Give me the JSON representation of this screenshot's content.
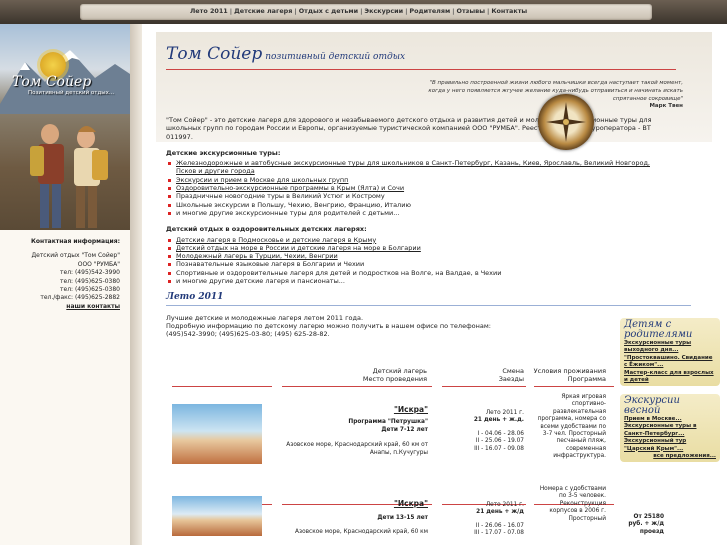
{
  "nav": {
    "items": [
      "Лето 2011",
      "Детские лагеря",
      "Отдых с детьми",
      "Экскурсии",
      "Родителям",
      "Отзывы",
      "Контакты"
    ]
  },
  "logo": {
    "title": "Том Сойер",
    "subtitle": "Позитивный детский отдых..."
  },
  "contacts": {
    "heading": "Контактная информация:",
    "lines": [
      "Детский отдых \"Том Сойер\"",
      "ООО \"РУМБА\"",
      "тел: (495)542-3990",
      "тел: (495)625-0380",
      "тел: (495)625-0380",
      "тел./факс: (495)625-2882"
    ],
    "link": "наши контакты"
  },
  "header": {
    "title": "Том Сойер",
    "tagline": "позитивный детский отдых",
    "quote": "\"В правильно построенной жизни любого мальчишки всегда наступает такой момент, когда у него появляется жгучее желание куда-нибудь отправиться и начинать искать спрятанное сокровище\"",
    "quote_author": "Марк Твен"
  },
  "intro": "\"Том Сойер\" - это детские лагеря для здорового и незабываемого детского отдыха и развития детей и молодежи, экскурсионные туры для школьных групп по городам России и Европы, организуемые туристической компанией ООО \"РУМБА\". Реестровый номер туроператора - ВТ 011997.",
  "tours": {
    "heading": "Детские экскурсионные туры:",
    "items": [
      "Железнодорожные и автобусные экскурсионные туры для школьников в Санкт-Петербург, Казань, Киев, Ярославль, Великий Новгород, Псков и другие города",
      "Экскурсии и прием в Москве для школьных групп",
      "Оздоровительно-экскурсионные программы в Крым (Ялта) и Сочи",
      "Праздничные новогодние туры в Великий Устюг и Кострому",
      "Школьные экскурсии в Польшу, Чехию, Венгрию, Францию, Италию",
      "и многие другие экскурсионные туры для родителей с детьми..."
    ]
  },
  "camps": {
    "heading": "Детский отдых в оздоровительных детских лагерях:",
    "items": [
      "Детские лагеря в Подмосковье и детские лагеря в Крыму",
      "Детский отдых на море в России и детские лагеря на море в Болгарии",
      "Молодежный лагерь в Турции, Чехии, Венгрии",
      "Познавательные языковые лагеря в Болгарии и Чехии",
      "Спортивные и оздоровительные лагеря для детей и подростков на Волге, на Валдае, в Чехии",
      "и многие другие детские лагеря и пансионаты..."
    ]
  },
  "summer": {
    "heading": "Лето 2011",
    "text": [
      "Лучшие детские и молодежные лагеря летом 2011 года.",
      "Подробную информацию по детскому лагерю можно получить в нашем офисе по телефонам:",
      "(495)542-3990; (495)625-03-80; (495) 625-28-82."
    ]
  },
  "table": {
    "headers": {
      "camp": [
        "Детский лагерь",
        "Место проведения"
      ],
      "shift": [
        "Смена",
        "Заезды"
      ],
      "cond": [
        "Условия проживания",
        "Программа"
      ]
    },
    "rows": [
      {
        "name": "\"Искра\"",
        "program": "Программа \"Петрушка\"",
        "ages": "Дети 7-12 лет",
        "place": "Азовское море, Краснодарский край, 60 км от Анапы, п.Кучугуры",
        "season": "Лето 2011 г.",
        "days": "21 день + ж.д.",
        "dates": [
          "I - 04.06 - 28.06",
          "II - 25.06 - 19.07",
          "III - 16.07 - 09.08"
        ],
        "conditions": "Яркая игровая спортивно-развлекательная программа, номера со всеми удобствами по 3-7 чел. Просторный песчаный пляж, современная инфраструктура."
      },
      {
        "name": "\"Искра\"",
        "ages": "Дети 13-15 лет",
        "place": "Азовское море, Краснодарский край, 60 км",
        "season": "Лето 2011 г.",
        "days": "21 день + ж/д",
        "dates": [
          "II - 26.06 - 16.07",
          "III - 17.07 - 07.08"
        ],
        "conditions": "Номера с удобствами по 3-5 человек. Реконструкция корпусов в 2006 г. Просторный",
        "price": "От 25180 руб. + ж/д проезд"
      }
    ]
  },
  "sidebar": {
    "parents": {
      "title": "Детям с родителями",
      "links": [
        "Экскурсионные туры выходного дня...",
        "\"Простоквашино. Свидание с Ёжиком\"...",
        "Мастер-класс для взрослых и детей"
      ]
    },
    "spring": {
      "title": "Экскурсии весной",
      "links": [
        "Прием в Москве...",
        "Экскурсионные туры в Санкт-Петербург...",
        "Экскурсионный тур \"Царский Крым\"...",
        "все предложения..."
      ]
    }
  }
}
